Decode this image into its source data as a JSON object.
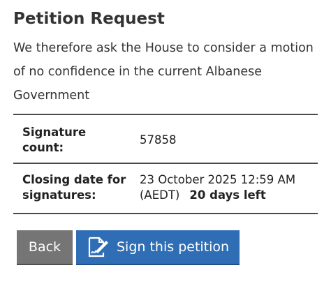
{
  "petition": {
    "heading": "Petition Request",
    "description": "We therefore ask the House to consider a motion of no confidence in the current Albanese Government"
  },
  "details": {
    "signature_count_label": "Signature count:",
    "signature_count_value": "57858",
    "closing_date_label": "Closing date for signatures:",
    "closing_date_value": "23 October 2025 12:59 AM (AEDT)",
    "days_left": "20 days left"
  },
  "actions": {
    "back_label": "Back",
    "sign_label": "Sign this petition",
    "sign_icon": "sign-document-icon"
  },
  "colors": {
    "back_button": "#757575",
    "sign_button": "#2f6eb5",
    "text": "#333333"
  }
}
